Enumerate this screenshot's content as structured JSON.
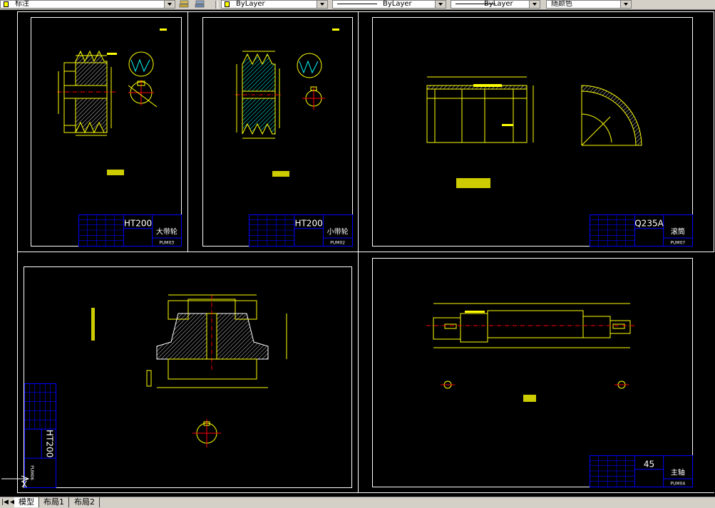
{
  "toolbar": {
    "text_style": "标注",
    "layer_color": "ByLayer",
    "linetype": "ByLayer",
    "lineweight": "ByLayer",
    "plot_style": "随颜色"
  },
  "sheets": [
    {
      "material": "HT200",
      "part_name": "大带轮",
      "drawing_no": "PUM03"
    },
    {
      "material": "HT200",
      "part_name": "小带轮",
      "drawing_no": "PUM02"
    },
    {
      "material": "Q235A",
      "part_name": "滚筒",
      "drawing_no": "PUM07"
    },
    {
      "material": "HT200",
      "part_name": "",
      "drawing_no": "PUM06"
    },
    {
      "material": "45",
      "part_name": "主轴",
      "drawing_no": "PUM04"
    }
  ],
  "tabs": {
    "model": "模型",
    "layout1": "布局1",
    "layout2": "布局2"
  },
  "colors": {
    "background": "#000000",
    "frame": "#ffffff",
    "title_block": "#0000ff",
    "geometry": "#ffff00",
    "hatch": "#00ffff",
    "centerline": "#ff0000"
  }
}
